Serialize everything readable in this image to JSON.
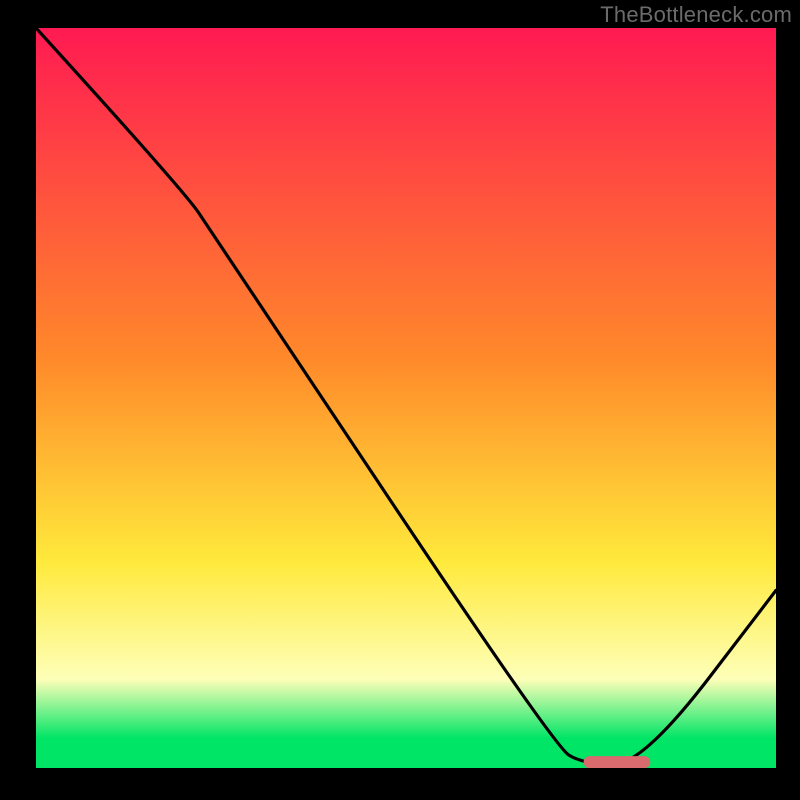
{
  "watermark": "TheBottleneck.com",
  "colors": {
    "red_top": "#ff1a52",
    "orange": "#ff8a2a",
    "yellow": "#ffe93b",
    "pale_yellow": "#feffb8",
    "green": "#00e566",
    "black": "#000000",
    "curve": "#000000",
    "pill": "#d96a6d"
  },
  "plot": {
    "inner_x": 36,
    "inner_y": 28,
    "inner_w": 740,
    "inner_h": 740
  },
  "chart_data": {
    "type": "line",
    "title": "",
    "xlabel": "",
    "ylabel": "",
    "xlim": [
      0,
      100
    ],
    "ylim": [
      0,
      100
    ],
    "legend": [],
    "annotations": [],
    "curve": [
      {
        "x": 0,
        "y": 100
      },
      {
        "x": 20,
        "y": 78
      },
      {
        "x": 24,
        "y": 72
      },
      {
        "x": 70,
        "y": 3
      },
      {
        "x": 74,
        "y": 0.5
      },
      {
        "x": 82,
        "y": 0.5
      },
      {
        "x": 100,
        "y": 24
      }
    ],
    "optimal_marker": {
      "x_start": 74,
      "x_end": 83,
      "y": 0.8
    },
    "gradient_stops_pct": [
      {
        "offset": 0,
        "color_key": "red_top"
      },
      {
        "offset": 45,
        "color_key": "orange"
      },
      {
        "offset": 72,
        "color_key": "yellow"
      },
      {
        "offset": 88,
        "color_key": "pale_yellow"
      },
      {
        "offset": 96,
        "color_key": "green"
      },
      {
        "offset": 100,
        "color_key": "green"
      }
    ]
  }
}
